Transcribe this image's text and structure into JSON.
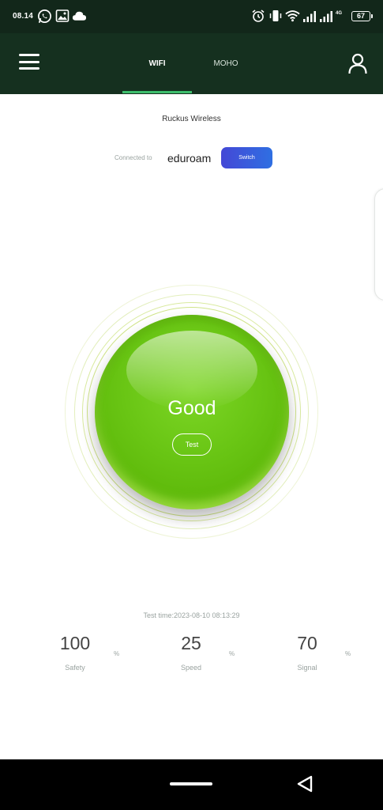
{
  "status_bar": {
    "time": "08.14",
    "battery": "67",
    "network_small": "4G",
    "icons": [
      "whatsapp-icon",
      "gallery-icon",
      "cloud-icon",
      "alarm-icon",
      "vibrate-icon",
      "wifi-icon",
      "signal-icon",
      "signal-icon",
      "battery-icon"
    ]
  },
  "header": {
    "tabs": [
      {
        "label": "WIFI",
        "active": true
      },
      {
        "label": "MOHO",
        "active": false
      }
    ],
    "icons": [
      "menu-icon",
      "user-icon"
    ],
    "accent_color": "#3dbd6c"
  },
  "connection": {
    "network_name": "Ruckus Wireless",
    "connected_label": "Connected to",
    "ssid": "eduroam",
    "switch_label": "Switch"
  },
  "gauge": {
    "status": "Good",
    "test_label": "Test",
    "color": "#66c212"
  },
  "results": {
    "test_time": "Test time:2023-08-10 08:13:29",
    "stats": [
      {
        "value": "100",
        "unit": "%",
        "label": "Safety"
      },
      {
        "value": "25",
        "unit": "%",
        "label": "Speed"
      },
      {
        "value": "70",
        "unit": "%",
        "label": "Signal"
      }
    ]
  },
  "nav": {
    "icons": [
      "home-pill-icon",
      "back-icon"
    ]
  }
}
